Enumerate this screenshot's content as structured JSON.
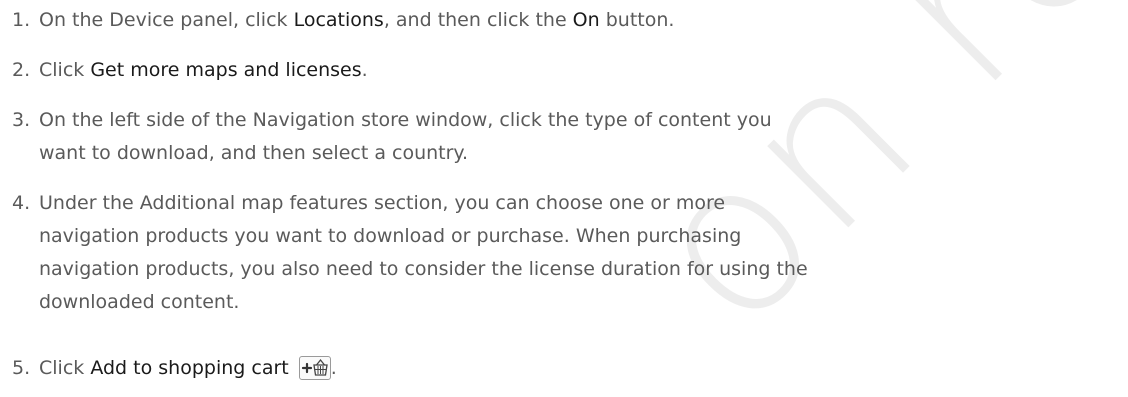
{
  "watermark": "on review",
  "steps": [
    {
      "number": "1.",
      "segments": [
        {
          "text": "On the Device panel, click ",
          "bold": false
        },
        {
          "text": "Locations",
          "bold": true
        },
        {
          "text": ", and then click the ",
          "bold": false
        },
        {
          "text": "On",
          "bold": true
        },
        {
          "text": " button.",
          "bold": false
        }
      ]
    },
    {
      "number": "2.",
      "segments": [
        {
          "text": "Click ",
          "bold": false
        },
        {
          "text": "Get more maps and licenses",
          "bold": true
        },
        {
          "text": ".",
          "bold": false
        }
      ]
    },
    {
      "number": "3.",
      "lines": [
        "On the left side of the Navigation store window, click the type of content you",
        "want to download, and then select a country."
      ]
    },
    {
      "number": "4.",
      "lines": [
        "Under the Additional map features section, you can choose one or more",
        "navigation products you want to download or purchase. When purchasing",
        "navigation products, you also need to consider the license duration for using the",
        "downloaded content."
      ]
    },
    {
      "number": "5.",
      "segments": [
        {
          "text": "Click ",
          "bold": false
        },
        {
          "text": "Add to shopping cart",
          "bold": true
        },
        {
          "text": " ",
          "bold": false
        }
      ],
      "icon": "add-to-cart-icon",
      "trailing": "."
    }
  ]
}
